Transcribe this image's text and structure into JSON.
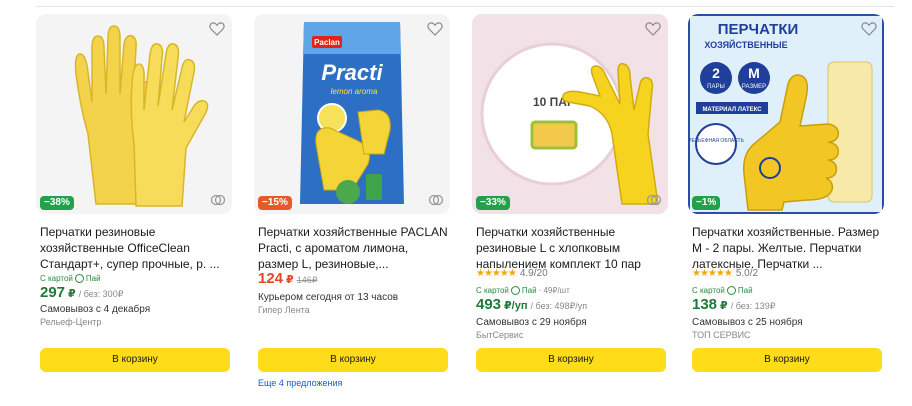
{
  "products": [
    {
      "discount": "−38%",
      "title": "Перчатки резиновые хозяйственные OfficeClean Стандарт+, супер прочные, р. ...",
      "pay_label": "С картой",
      "pay_name": "Пай",
      "price": "297",
      "currency": "₽",
      "no_card": "/ без: 300₽",
      "delivery": "Самовывоз с 4 декабря",
      "seller": "Рельеф-Центр",
      "cart": "В корзину"
    },
    {
      "discount": "−15%",
      "title": "Перчатки хозяйственные PACLAN Practi, с ароматом лимона, размер L, резиновые,...",
      "price": "124",
      "currency": "₽",
      "old_price": "146₽",
      "delivery": "Курьером сегодня от 13 часов",
      "seller": "Гипер Лента",
      "cart": "В корзину",
      "more_offers": "Еще 4 предложения",
      "brand_text": "Paclan",
      "product_text": "Practi",
      "aroma_text": "lemon aroma"
    },
    {
      "discount": "−33%",
      "title": "Перчатки хозяйственные резиновые L с хлопковым напылением комплект 10 пар",
      "rating": "4.9",
      "reviews": "/20",
      "pay_label": "С картой",
      "pay_name": "Пай",
      "pay_unit": "· 49₽/шт",
      "price": "493",
      "currency": "₽/уп",
      "no_card": "/ без: 498₽/уп",
      "delivery": "Самовывоз с 29 ноября",
      "seller": "БытСервис",
      "cart": "В корзину",
      "pack_text": "10 ПАР"
    },
    {
      "discount": "−1%",
      "title": "Перчатки хозяйственные. Размер M - 2 пары. Желтые. Перчатки латексные. Перчатки ...",
      "rating": "5.0",
      "reviews": "/2",
      "pay_label": "С картой",
      "pay_name": "Пай",
      "price": "138",
      "currency": "₽",
      "no_card": "/ без: 139₽",
      "delivery": "Самовывоз с 25 ноября",
      "seller": "ТОП СЕРВИС",
      "cart": "В корзину",
      "img_title1": "ПЕРЧАТКИ",
      "img_title2": "ХОЗЯЙСТВЕННЫЕ",
      "img_pairs_num": "2",
      "img_pairs_word": "ПАРЫ",
      "img_size_letter": "M",
      "img_size_word": "РАЗМЕР",
      "img_material": "МАТЕРИАЛ ЛАТЕКС",
      "img_ribbed": "РЕЛЬЕФНАЯ ОБЛАСТЬ"
    }
  ]
}
